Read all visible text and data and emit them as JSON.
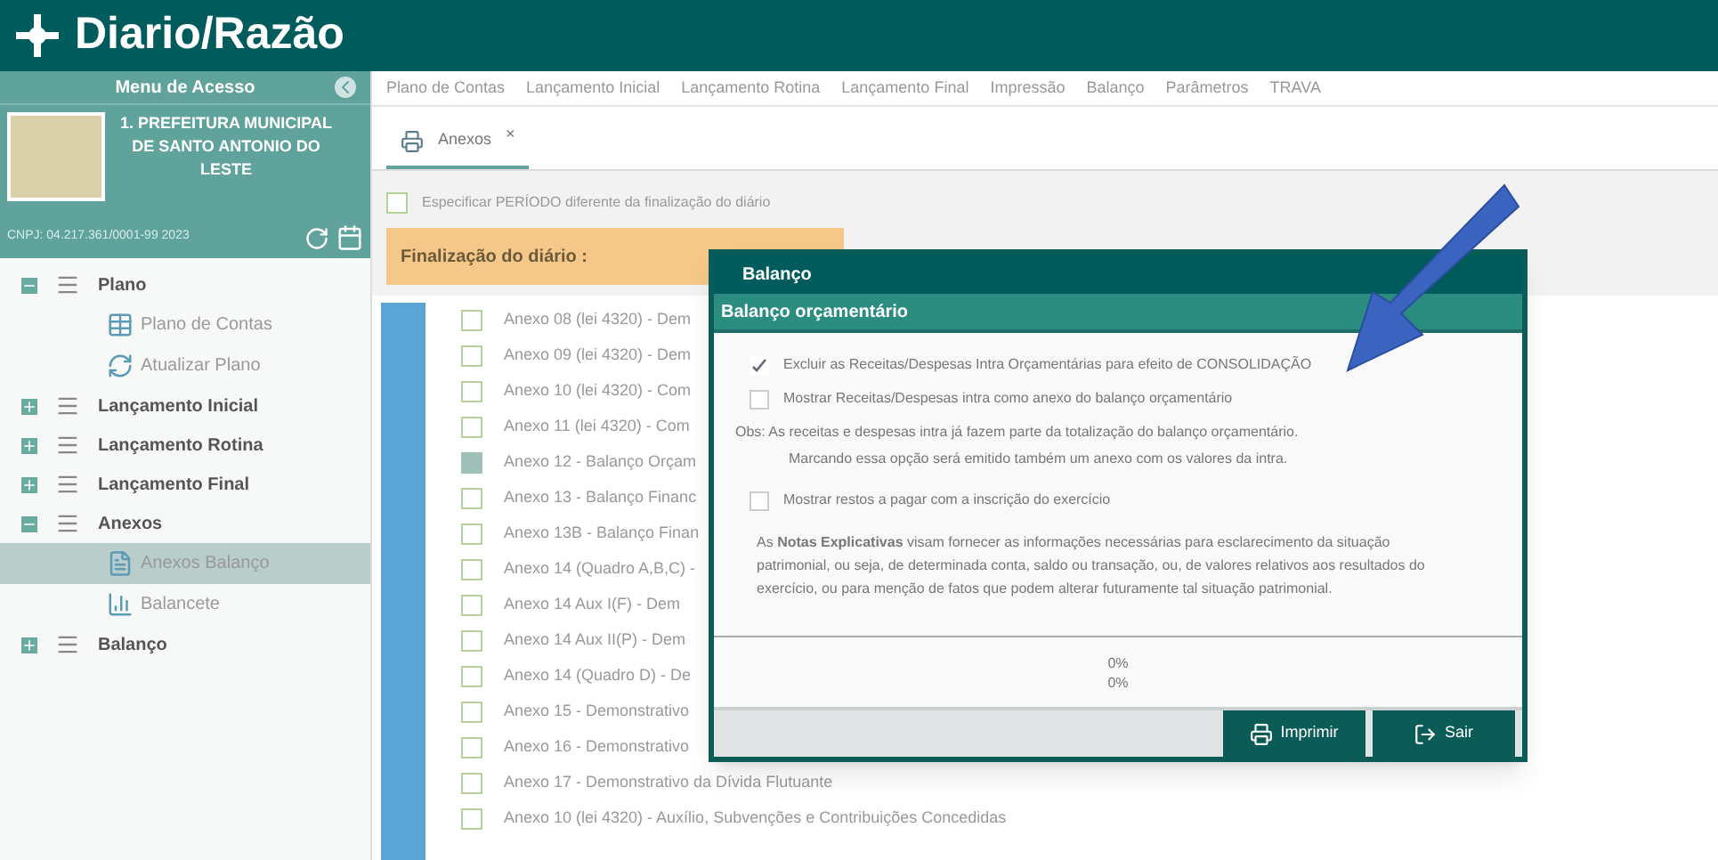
{
  "app": {
    "title": "Diario/Razão"
  },
  "sidebar": {
    "header": "Menu de Acesso",
    "entity": "1. PREFEITURA MUNICIPAL DE SANTO ANTONIO DO LESTE",
    "cnpj": "CNPJ: 04.217.361/0001-99 2023",
    "tree": [
      {
        "label": "Plano",
        "expanded": true,
        "children": [
          {
            "label": "Plano de Contas",
            "selected": false,
            "kind": "grid"
          },
          {
            "label": "Atualizar Plano",
            "selected": false,
            "kind": "refresh"
          }
        ]
      },
      {
        "label": "Lançamento Inicial",
        "expanded": false
      },
      {
        "label": "Lançamento Rotina",
        "expanded": false
      },
      {
        "label": "Lançamento Final",
        "expanded": false
      },
      {
        "label": "Anexos",
        "expanded": true,
        "children": [
          {
            "label": "Anexos Balanço",
            "selected": true,
            "kind": "report"
          },
          {
            "label": "Balancete",
            "selected": false,
            "kind": "sheet"
          }
        ]
      },
      {
        "label": "Balanço",
        "expanded": false
      }
    ]
  },
  "menu": [
    "Plano de Contas",
    "Lançamento Inicial",
    "Lançamento Rotina",
    "Lançamento Final",
    "Impressão",
    "Balanço",
    "Parâmetros",
    "TRAVA"
  ],
  "tabs": [
    {
      "label": "Anexos",
      "selected": true,
      "close": "×"
    }
  ],
  "period_option": {
    "label": "Especificar PERÍODO diferente da finalização do diário",
    "checked": false
  },
  "finalization": {
    "label": "Finalização do diário :"
  },
  "annexes": [
    {
      "label": "Anexo 08 (lei 4320) - Dem",
      "checked": false
    },
    {
      "label": "Anexo 09 (lei 4320) - Dem",
      "checked": false
    },
    {
      "label": "Anexo 10 (lei 4320) - Com",
      "checked": false
    },
    {
      "label": "Anexo 11 (lei 4320) - Com",
      "checked": false
    },
    {
      "label": "Anexo 12 - Balanço Orçam",
      "checked": true
    },
    {
      "label": "Anexo 13 - Balanço Financ",
      "checked": false
    },
    {
      "label": "Anexo 13B - Balanço Finan",
      "checked": false
    },
    {
      "label": "Anexo 14 (Quadro A,B,C) -",
      "checked": false
    },
    {
      "label": "Anexo 14 Aux I(F) - Dem",
      "checked": false
    },
    {
      "label": "Anexo 14 Aux II(P) - Dem",
      "checked": false
    },
    {
      "label": "Anexo 14 (Quadro D) - De",
      "checked": false
    },
    {
      "label": "Anexo 15 - Demonstrativo",
      "checked": false
    },
    {
      "label": "Anexo 16 - Demonstrativo",
      "checked": false
    },
    {
      "label": "Anexo 17 - Demonstrativo da Dívida Flutuante",
      "checked": false
    },
    {
      "label": "Anexo 10 (lei 4320) - Auxílio, Subvenções e Contribuições Concedidas",
      "checked": false
    }
  ],
  "dialog": {
    "title": "Balanço",
    "section": "Balanço orçamentário",
    "items": [
      {
        "kind": "checkbox",
        "label": "Excluir as Receitas/Despesas Intra Orçamentárias para efeito de CONSOLIDAÇÃO",
        "checked": true
      },
      {
        "kind": "checkbox",
        "label": "Mostrar Receitas/Despesas intra como anexo do balanço orçamentário",
        "checked": false
      },
      {
        "kind": "note",
        "label": "Obs: As receitas e despesas intra já fazem parte da totalização do balanço orçamentário."
      },
      {
        "kind": "note_indent",
        "label": "Marcando essa opção será emitido também um anexo com os valores da intra."
      },
      {
        "kind": "checkbox",
        "label": "Mostrar restos a pagar com a inscrição do exercício",
        "checked": false
      },
      {
        "kind": "paragraph",
        "label": "As **Notas Explicativas**   visam fornecer as informações necessárias para esclarecimento da situação patrimonial, ou seja, de determinada conta, saldo ou transação, ou, de valores relativos aos resultados do exercício, ou para menção de fatos que podem alterar futuramente tal situação patrimonial."
      }
    ],
    "progress": [
      "0%",
      "0%"
    ],
    "buttons": [
      {
        "label": "Imprimir",
        "kind": "print"
      },
      {
        "label": "Sair",
        "kind": "exit"
      }
    ]
  }
}
